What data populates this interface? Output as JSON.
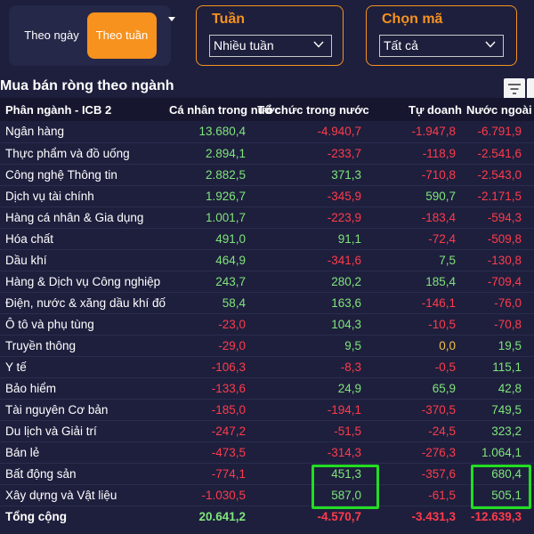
{
  "toggle": {
    "by_day": "Theo ngày",
    "by_week": "Theo tuần"
  },
  "filters": {
    "week": {
      "label": "Tuần",
      "value": "Nhiều tuần"
    },
    "code": {
      "label": "Chọn mã",
      "value": "Tất cả"
    }
  },
  "title": "Mua bán ròng theo ngành",
  "colors": {
    "accent": "#f7921e",
    "positive": "#7fe57a",
    "negative": "#ff3b4a",
    "zero": "#f5c242",
    "highlight": "#22dd22",
    "background": "#1e1f3d"
  },
  "icons": {
    "filter": "filter-lines-icon",
    "sort": "sort-down-icon",
    "chevron": "chevron-down-icon"
  },
  "table": {
    "headers": [
      "Phân ngành - ICB 2",
      "Cá nhân trong nước",
      "Tổ chức trong nước",
      "Tự doanh",
      "Nước ngoài"
    ],
    "rows": [
      [
        "Ngân hàng",
        "13.680,4",
        "-4.940,7",
        "-1.947,8",
        "-6.791,9"
      ],
      [
        "Thực phẩm và đồ uống",
        "2.894,1",
        "-233,7",
        "-118,9",
        "-2.541,6"
      ],
      [
        "Công nghệ Thông tin",
        "2.882,5",
        "371,3",
        "-710,8",
        "-2.543,0"
      ],
      [
        "Dịch vụ tài chính",
        "1.926,7",
        "-345,9",
        "590,7",
        "-2.171,5"
      ],
      [
        "Hàng cá nhân & Gia dụng",
        "1.001,7",
        "-223,9",
        "-183,4",
        "-594,3"
      ],
      [
        "Hóa chất",
        "491,0",
        "91,1",
        "-72,4",
        "-509,8"
      ],
      [
        "Dầu khí",
        "464,9",
        "-341,6",
        "7,5",
        "-130,8"
      ],
      [
        "Hàng & Dịch vụ Công nghiệp",
        "243,7",
        "280,2",
        "185,4",
        "-709,4"
      ],
      [
        "Điện, nước & xăng dầu khí đốt",
        "58,4",
        "163,6",
        "-146,1",
        "-76,0"
      ],
      [
        "Ô tô và phụ tùng",
        "-23,0",
        "104,3",
        "-10,5",
        "-70,8"
      ],
      [
        "Truyền thông",
        "-29,0",
        "9,5",
        "0,0",
        "19,5"
      ],
      [
        "Y tế",
        "-106,3",
        "-8,3",
        "-0,5",
        "115,1"
      ],
      [
        "Bảo hiểm",
        "-133,6",
        "24,9",
        "65,9",
        "42,8"
      ],
      [
        "Tài nguyên Cơ bản",
        "-185,0",
        "-194,1",
        "-370,5",
        "749,5"
      ],
      [
        "Du lịch và Giải trí",
        "-247,2",
        "-51,5",
        "-24,5",
        "323,2"
      ],
      [
        "Bán lẻ",
        "-473,5",
        "-314,3",
        "-276,3",
        "1.064,1"
      ],
      [
        "Bất động sản",
        "-774,1",
        "451,3",
        "-357,6",
        "680,4"
      ],
      [
        "Xây dựng và Vật liệu",
        "-1.030,5",
        "587,0",
        "-61,5",
        "505,1"
      ]
    ],
    "total": [
      "Tổng cộng",
      "20.641,2",
      "-4.570,7",
      "-3.431,3",
      "-12.639,3"
    ]
  }
}
